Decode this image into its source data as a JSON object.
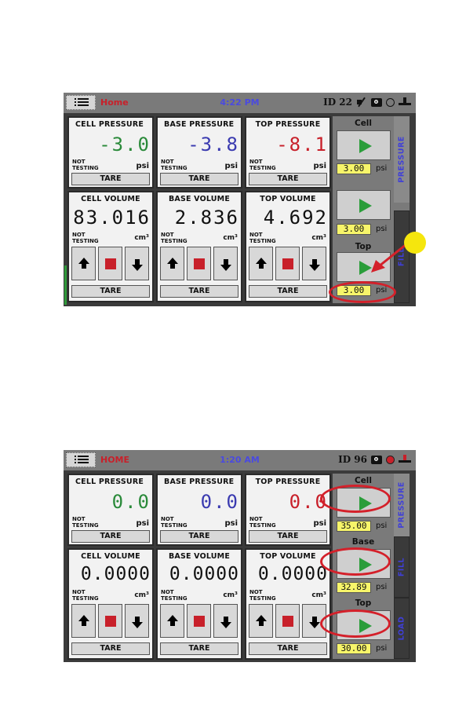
{
  "screens": [
    {
      "topbar": {
        "home_label": "Home",
        "time": "4:22 PM",
        "id_label": "ID 22",
        "icons": [
          "menu-icon",
          "mute-icon",
          "camera-icon",
          "globe-icon",
          "network-icon"
        ]
      },
      "pressure_panels": [
        {
          "title": "CELL PRESSURE",
          "value": "-3.0",
          "status": "NOT TESTING",
          "unit": "psi",
          "tare": "TARE",
          "color": "#2a8a3a"
        },
        {
          "title": "BASE PRESSURE",
          "value": "-3.8",
          "status": "NOT TESTING",
          "unit": "psi",
          "tare": "TARE",
          "color": "#3a3ab0"
        },
        {
          "title": "TOP PRESSURE",
          "value": "-8.1",
          "status": "NOT TESTING",
          "unit": "psi",
          "tare": "TARE",
          "color": "#c8202a"
        }
      ],
      "volume_panels": [
        {
          "title": "CELL VOLUME",
          "value": "83.016",
          "status": "NOT TESTING",
          "unit": "cm³",
          "tare": "TARE"
        },
        {
          "title": "BASE VOLUME",
          "value": "2.836",
          "status": "NOT TESTING",
          "unit": "cm³",
          "tare": "TARE"
        },
        {
          "title": "TOP VOLUME",
          "value": "4.692",
          "status": "NOT TESTING",
          "unit": "cm³",
          "tare": "TARE"
        }
      ],
      "side": {
        "controls": [
          {
            "label": "Cell",
            "setpoint": "3.00",
            "unit": "psi"
          },
          {
            "label": "",
            "setpoint": "3.00",
            "unit": "psi"
          },
          {
            "label": "Top",
            "setpoint": "3.00",
            "unit": "psi"
          }
        ],
        "tabs": [
          "PRESSURE",
          "FILL"
        ]
      }
    },
    {
      "topbar": {
        "home_label": "HOME",
        "time": "1:20 AM",
        "id_label": "ID 96",
        "icons": [
          "menu-icon",
          "camera-icon",
          "globe-icon",
          "network-icon"
        ]
      },
      "pressure_panels": [
        {
          "title": "CELL PRESSURE",
          "value": "0.0",
          "status": "NOT TESTING",
          "unit": "psi",
          "tare": "TARE",
          "color": "#2a8a3a"
        },
        {
          "title": "BASE PRESSURE",
          "value": "0.0",
          "status": "NOT TESTING",
          "unit": "psi",
          "tare": "TARE",
          "color": "#3a3ab0"
        },
        {
          "title": "TOP PRESSURE",
          "value": "0.0",
          "status": "NOT TESTING",
          "unit": "psi",
          "tare": "TARE",
          "color": "#c8202a"
        }
      ],
      "volume_panels": [
        {
          "title": "CELL VOLUME",
          "value": "0.0000",
          "status": "NOT TESTING",
          "unit": "cm³",
          "tare": "TARE"
        },
        {
          "title": "BASE VOLUME",
          "value": "0.0000",
          "status": "NOT TESTING",
          "unit": "cm³",
          "tare": "TARE"
        },
        {
          "title": "TOP VOLUME",
          "value": "0.0000",
          "status": "NOT TESTING",
          "unit": "cm³",
          "tare": "TARE"
        }
      ],
      "side": {
        "controls": [
          {
            "label": "Cell",
            "setpoint": "35.00",
            "unit": "psi"
          },
          {
            "label": "Base",
            "setpoint": "32.89",
            "unit": "psi"
          },
          {
            "label": "Top",
            "setpoint": "30.00",
            "unit": "psi"
          }
        ],
        "tabs": [
          "PRESSURE",
          "FILL",
          "LOAD"
        ]
      }
    }
  ],
  "colors": {
    "home": "#c8202a",
    "clock": "#4a4ae0",
    "play": "#2a9d3a",
    "setpoint_bg": "#f7f56a",
    "tab_text": "#3f3fd8",
    "annotation": "#d4202a",
    "callout_dot": "#f5e60d"
  }
}
